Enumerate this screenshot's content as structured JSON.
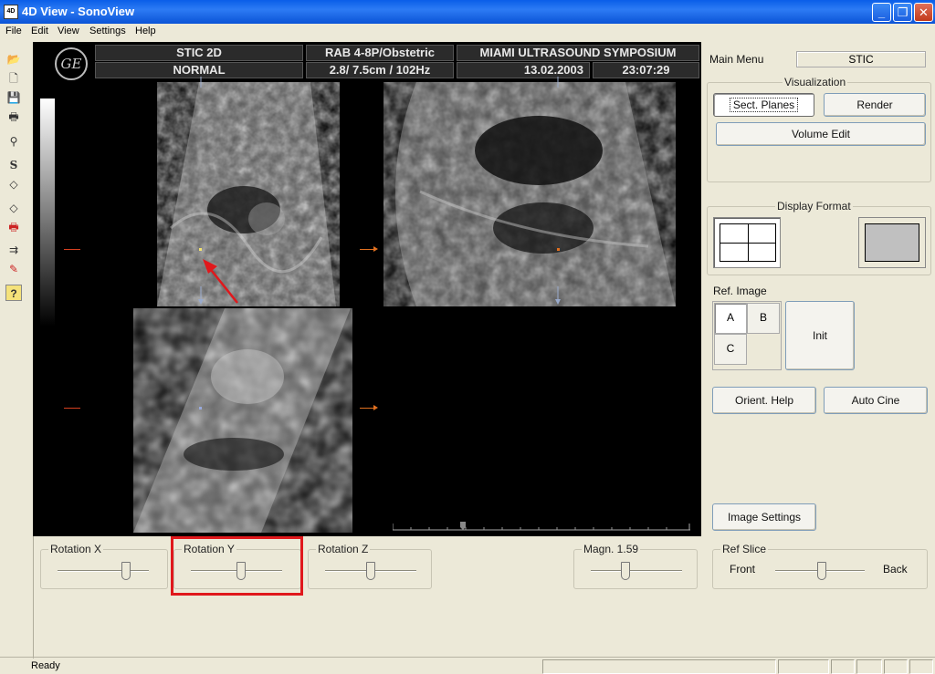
{
  "window": {
    "title": "4D View - SonoView",
    "icon_text": "4D",
    "controls": {
      "minimize": "_",
      "maximize": "❐",
      "close": "✕"
    }
  },
  "menu": {
    "items": [
      "File",
      "Edit",
      "View",
      "Settings",
      "Help"
    ]
  },
  "toolbar": {
    "icons": [
      "open-folder-icon",
      "new-document-icon",
      "save-icon",
      "print-icon",
      "patient-icon",
      "s-icon",
      "slice-icon",
      "slice-alt-icon",
      "print-report-icon",
      "measure-icon",
      "report-edit-icon",
      "help-icon"
    ],
    "glyphs": [
      "📂",
      "🗋",
      "💾",
      "🖶",
      "⚲",
      "S",
      "◇",
      "◇",
      "🖶",
      "⇉",
      "✎",
      "?"
    ]
  },
  "viewport": {
    "logo_text": "GE",
    "header": {
      "mode": "STIC 2D",
      "submode": "NORMAL",
      "probe": "RAB 4-8P/Obstetric",
      "params": "2.8/ 7.5cm / 102Hz",
      "institution": "MIAMI ULTRASOUND SYMPOSIUM",
      "date": "13.02.2003",
      "time": "23:07:29"
    }
  },
  "bottom": {
    "rotation_x": {
      "label": "Rotation X",
      "value_fraction": 0.75
    },
    "rotation_y": {
      "label": "Rotation Y",
      "value_fraction": 0.55
    },
    "rotation_z": {
      "label": "Rotation Z",
      "value_fraction": 0.5
    },
    "magnification": {
      "label": "Magn. 1.59",
      "value_fraction": 0.38
    },
    "ref_slice": {
      "label": "Ref Slice",
      "front": "Front",
      "back": "Back",
      "value_fraction": 0.52
    }
  },
  "panel": {
    "main_menu_label": "Main Menu",
    "main_menu_value": "STIC",
    "visualization": {
      "label": "Visualization",
      "sect_planes": "Sect. Planes",
      "render": "Render",
      "volume_edit": "Volume Edit"
    },
    "display_format": {
      "label": "Display Format"
    },
    "ref_image": {
      "label": "Ref. Image",
      "a": "A",
      "b": "B",
      "c": "C",
      "init": "Init"
    },
    "orient_help": "Orient. Help",
    "auto_cine": "Auto Cine",
    "image_settings": "Image Settings"
  },
  "status": {
    "text": "Ready"
  },
  "colors": {
    "highlight": "#e0181c",
    "annotation_arrow": "#e0181c",
    "titlebar": "#0a5ee8"
  }
}
